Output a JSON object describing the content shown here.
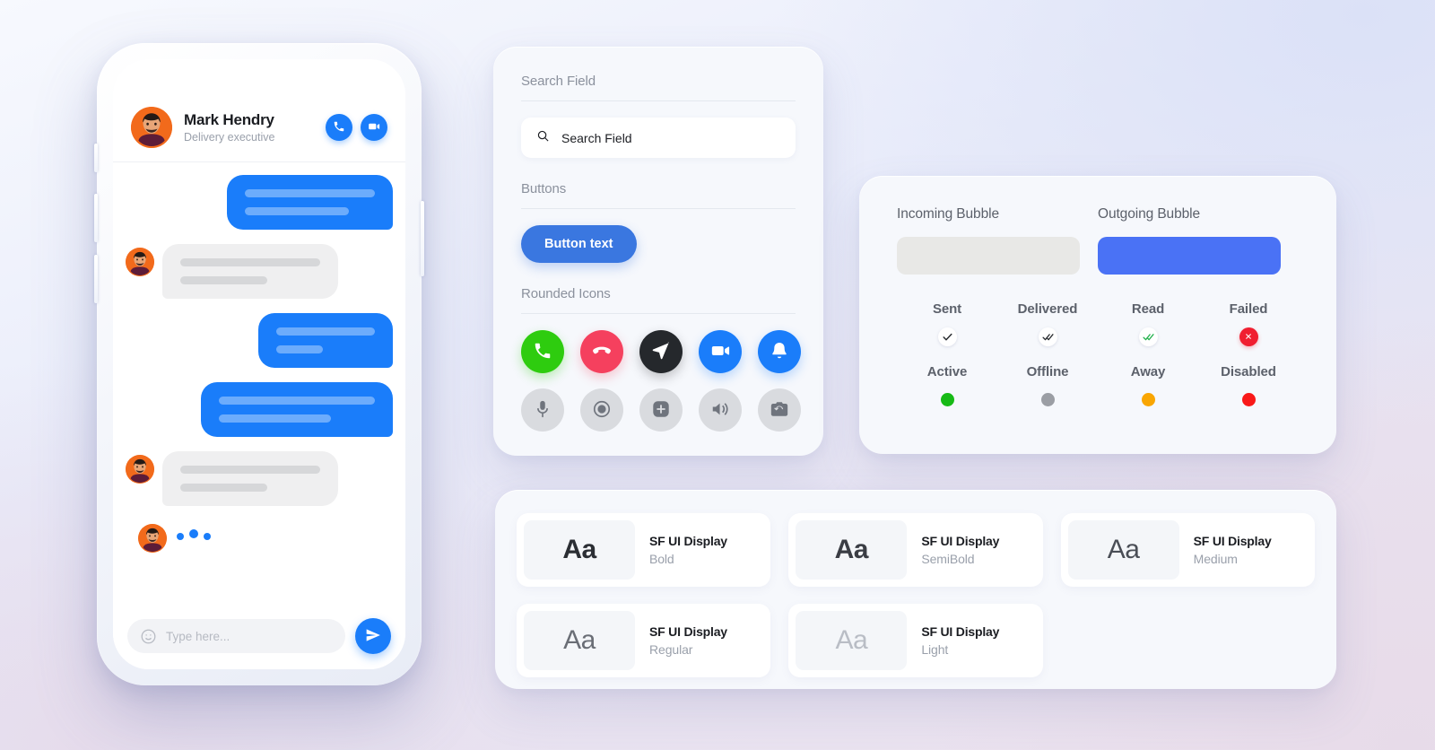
{
  "theme": {
    "accent_blue": "#1a7dfa",
    "button_blue": "#3a77e0",
    "bubble_out_blue": "#4a72f5",
    "green": "#2ecc0f",
    "red": "#f5405e",
    "dark": "#25282c",
    "gray": "#d9dbdf"
  },
  "phone": {
    "header": {
      "name": "Mark Hendry",
      "subtitle": "Delivery executive",
      "actions": [
        {
          "icon": "phone-icon",
          "name": "voice-call"
        },
        {
          "icon": "video-icon",
          "name": "video-call"
        }
      ]
    },
    "messages": [
      {
        "direction": "out",
        "lines": 2,
        "avatar": false
      },
      {
        "direction": "in",
        "lines": 2,
        "avatar": true
      },
      {
        "direction": "out",
        "lines": 2,
        "avatar": false
      },
      {
        "direction": "out",
        "lines": 2,
        "avatar": false
      },
      {
        "direction": "in",
        "lines": 2,
        "avatar": true
      }
    ],
    "typing_indicator": {
      "dots": 3
    },
    "input": {
      "placeholder": "Type here...",
      "value": "",
      "emoji_icon": "smiley-icon",
      "send_icon": "send-icon"
    }
  },
  "components": {
    "search_section_label": "Search Field",
    "search": {
      "icon": "search-icon",
      "placeholder": "Search Field",
      "value": ""
    },
    "buttons_section_label": "Buttons",
    "primary_button_label": "Button text",
    "icons_section_label": "Rounded Icons",
    "icons_row_1": [
      {
        "name": "phone-call-icon",
        "color": "#2ecc0f"
      },
      {
        "name": "end-call-icon",
        "color": "#f5405e"
      },
      {
        "name": "send-icon",
        "color": "#25282c"
      },
      {
        "name": "video-camera-icon",
        "color": "#1a7dfa"
      },
      {
        "name": "bell-icon",
        "color": "#1a7dfa"
      }
    ],
    "icons_row_2": [
      {
        "name": "microphone-icon",
        "color": "#d9dbdf"
      },
      {
        "name": "record-icon",
        "color": "#d9dbdf"
      },
      {
        "name": "add-plus-icon",
        "color": "#d9dbdf"
      },
      {
        "name": "speaker-icon",
        "color": "#d9dbdf"
      },
      {
        "name": "switch-camera-icon",
        "color": "#d9dbdf"
      }
    ]
  },
  "status_panel": {
    "incoming_label": "Incoming Bubble",
    "outgoing_label": "Outgoing Bubble",
    "message_states": [
      {
        "label": "Sent",
        "mark": "single-check",
        "color": "#25282c"
      },
      {
        "label": "Delivered",
        "mark": "double-check",
        "color": "#25282c"
      },
      {
        "label": "Read",
        "mark": "double-check",
        "color": "#22b14c"
      },
      {
        "label": "Failed",
        "mark": "error-cross",
        "color": "#f01e30"
      }
    ],
    "presence_states": [
      {
        "label": "Active",
        "color": "#17ba16"
      },
      {
        "label": "Offline",
        "color": "#9b9ea4"
      },
      {
        "label": "Away",
        "color": "#f9a602"
      },
      {
        "label": "Disabled",
        "color": "#f91919"
      }
    ]
  },
  "typography": {
    "sample_glyph": "Aa",
    "cards": [
      {
        "family": "SF UI Display",
        "weight": "Bold",
        "class": "w-bold"
      },
      {
        "family": "SF UI Display",
        "weight": "SemiBold",
        "class": "w-semibold"
      },
      {
        "family": "SF UI Display",
        "weight": "Medium",
        "class": "w-medium"
      },
      {
        "family": "SF UI Display",
        "weight": "Regular",
        "class": "w-regular"
      },
      {
        "family": "SF UI Display",
        "weight": "Light",
        "class": "w-light"
      }
    ]
  }
}
